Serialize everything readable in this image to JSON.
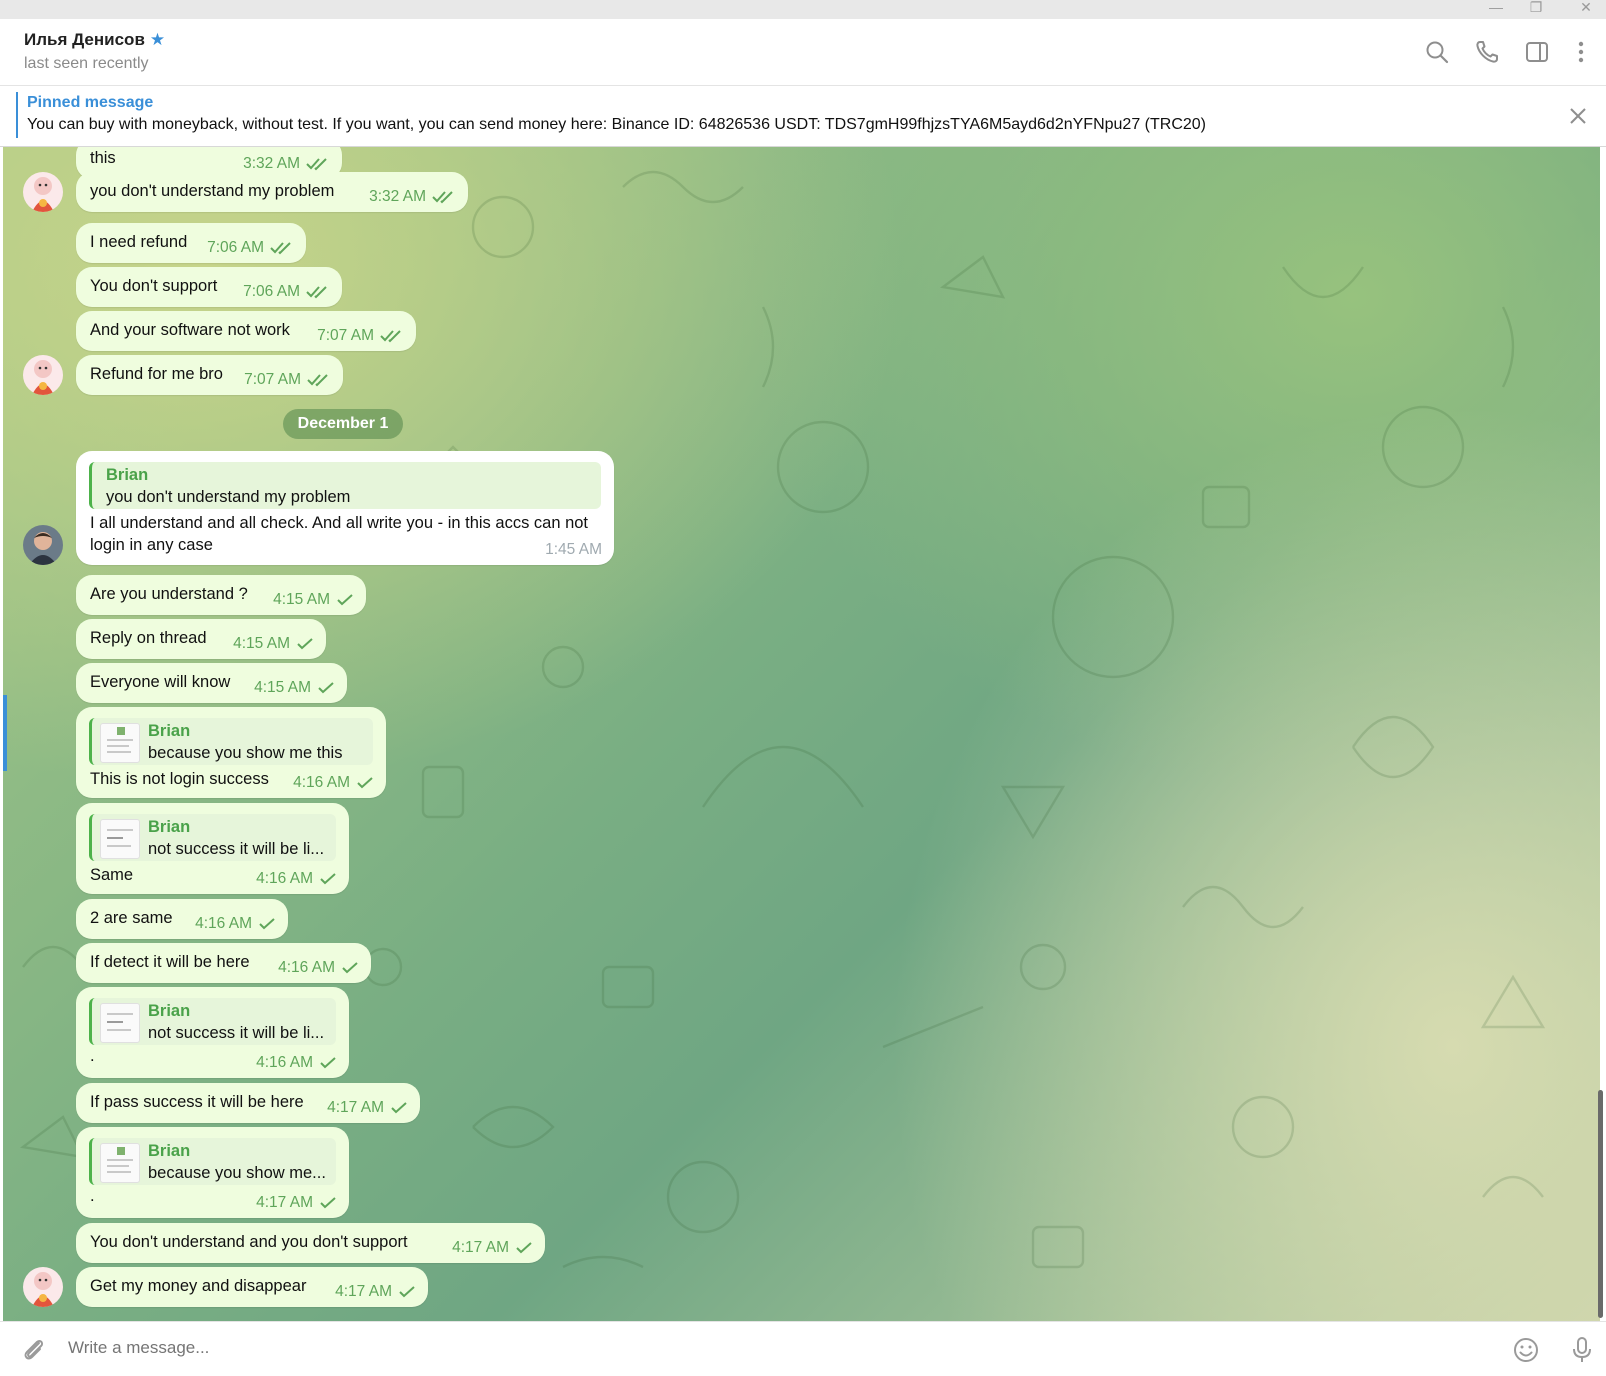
{
  "header": {
    "name": "Илья Денисов",
    "status": "last seen recently"
  },
  "pinned": {
    "title": "Pinned message",
    "text": "You can buy with moneyback, without test. If you want, you can send money here: Binance ID: 64826536 USDT: TDS7gmH99fhjzsTYA6M5ayd6d2nYFNpu27 (TRC20)"
  },
  "date_separator": "December 1",
  "messages_before": [
    {
      "text": "this",
      "time": "3:32 AM"
    },
    {
      "text": "you don't understand my problem",
      "time": "3:32 AM"
    },
    {
      "text": "I need refund",
      "time": "7:06 AM"
    },
    {
      "text": "You don't support",
      "time": "7:06 AM"
    },
    {
      "text": "And your software not work",
      "time": "7:07 AM"
    },
    {
      "text": "Refund for me bro",
      "time": "7:07 AM"
    }
  ],
  "incoming": {
    "reply_author": "Brian",
    "reply_text": "you don't understand my problem",
    "line1": "I all understand and all check. And all write you - in this accs can not",
    "line2": "login in any case",
    "time": "1:45 AM"
  },
  "messages_after": [
    {
      "text": "Are you understand ?",
      "time": "4:15 AM"
    },
    {
      "text": "Reply on thread",
      "time": "4:15 AM"
    },
    {
      "text": "Everyone will know",
      "time": "4:15 AM"
    },
    {
      "reply_author": "Brian",
      "reply_text": "because you show me this",
      "text": "This is not login success",
      "time": "4:16 AM"
    },
    {
      "reply_author": "Brian",
      "reply_text": "not success it will be li...",
      "text": "Same",
      "time": "4:16 AM"
    },
    {
      "text": "2 are same",
      "time": "4:16 AM"
    },
    {
      "text": "If detect it will be here",
      "time": "4:16 AM"
    },
    {
      "reply_author": "Brian",
      "reply_text": "not success it will be li...",
      "text": ".",
      "time": "4:16 AM"
    },
    {
      "text": "If pass success it will be here",
      "time": "4:17 AM"
    },
    {
      "reply_author": "Brian",
      "reply_text": "because you show me...",
      "text": ".",
      "time": "4:17 AM"
    },
    {
      "text": "You don't understand and you don't support",
      "time": "4:17 AM"
    },
    {
      "text": "Get my money and disappear",
      "time": "4:17 AM"
    }
  ],
  "composer": {
    "placeholder": "Write a message..."
  },
  "icons": {
    "star": "★",
    "minimize": "—",
    "maximize": "❐",
    "close": "✕"
  },
  "colors": {
    "accent": "#3a8fd8",
    "bubble_out": "#effdde",
    "bubble_in": "#ffffff",
    "time_out": "#5fa55a",
    "reply_author": "#4aa24a"
  }
}
